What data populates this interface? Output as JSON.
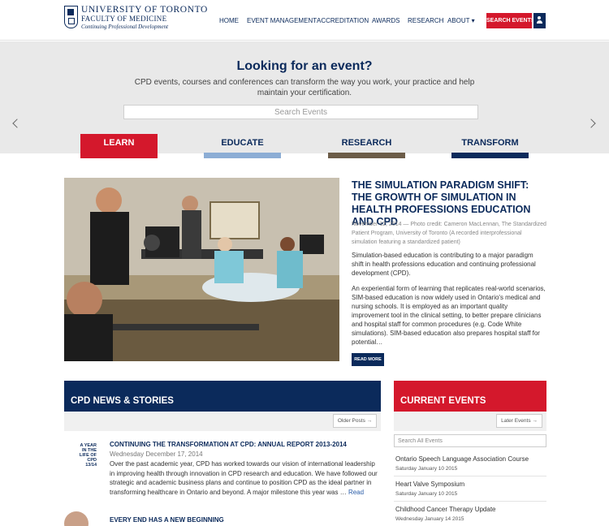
{
  "header": {
    "logo_line1": "UNIVERSITY OF TORONTO",
    "logo_line2": "FACULTY OF MEDICINE",
    "logo_line3": "Continuing Professional Development",
    "nav": [
      "HOME",
      "EVENT MANAGEMENT",
      "ACCREDITATION",
      "AWARDS",
      "RESEARCH",
      "ABOUT ▾"
    ],
    "search_button": "SEARCH EVENTS",
    "user_icon": "user-icon"
  },
  "hero": {
    "title": "Looking for an event?",
    "description": "CPD events, courses and conferences can transform the way you work, your practice and help maintain your certification.",
    "search_placeholder": "Search Events"
  },
  "tabs": [
    "LEARN",
    "EDUCATE",
    "RESEARCH",
    "TRANSFORM"
  ],
  "feature": {
    "title": "THE SIMULATION PARADIGM SHIFT: THE GROWTH OF SIMULATION IN HEALTH PROFESSIONS EDUCATION AND CPD",
    "meta": "November 12, 2014 — Photo credit: Cameron MacLennan, The Standardized Patient Program, University of Toronto (A recorded interprofessional simulation featuring a standardized patient)",
    "p1": "Simulation-based education is contributing to a major paradigm shift in health professions education and continuing professional development (CPD).",
    "p2": "An experiential form of learning that replicates real-world scenarios, SIM-based education is now widely used in Ontario's medical and nursing schools. It is employed as an important quality improvement tool in the clinical setting, to better prepare clinicians and hospital staff for common procedures (e.g. Code White simulations). SIM-based education also prepares hospital staff for potential…",
    "read_more": "READ MORE"
  },
  "news": {
    "title": "CPD NEWS & STORIES",
    "older_button": "Older Posts →",
    "items": [
      {
        "title": "CONTINUING THE TRANSFORMATION AT CPD: ANNUAL REPORT 2013-2014",
        "date": "Wednesday December 17, 2014",
        "body": "Over the past academic year, CPD has worked towards our vision of international leadership in improving health through innovation in CPD research and education. We have followed our strategic and academic business plans and continue to position CPD as the ideal partner in transforming healthcare in Ontario and beyond. A major milestone this year was … ",
        "read": "Read",
        "thumb_lines": [
          "A YEAR",
          "IN THE",
          "LIFE OF",
          "CPD",
          "13/14"
        ]
      },
      {
        "title": "EVERY END HAS A NEW BEGINNING"
      }
    ]
  },
  "events": {
    "title": "CURRENT EVENTS",
    "later_button": "Later Events →",
    "search_placeholder": "Search All Events",
    "items": [
      {
        "title": "Ontario Speech Language Association Course",
        "date": "Saturday January 10 2015"
      },
      {
        "title": "Heart Valve Symposium",
        "date": "Saturday January 10 2015"
      },
      {
        "title": "Childhood Cancer Therapy Update",
        "date": "Wednesday January 14 2015"
      }
    ]
  },
  "colors": {
    "navy": "#0b2a5b",
    "red": "#d4182c",
    "light_blue": "#8cadd5",
    "brown": "#6c5c48",
    "hero_bg": "#e9e9e9"
  }
}
